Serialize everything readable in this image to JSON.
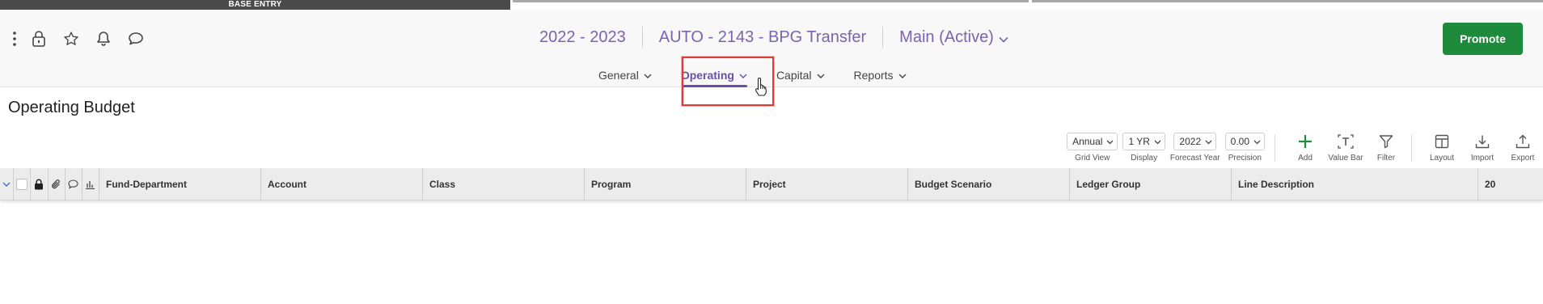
{
  "progress": {
    "stage_label": "BASE ENTRY"
  },
  "header": {
    "left_icons": [
      "more-vertical-icon",
      "lock-icon",
      "star-icon",
      "bell-icon",
      "comment-icon"
    ],
    "fiscal_year": "2022 - 2023",
    "process_name": "AUTO - 2143 - BPG Transfer",
    "scenario": "Main (Active)",
    "promote_label": "Promote",
    "brand_color": "#7b63b0",
    "promote_color": "#1e8a3c"
  },
  "nav": {
    "tabs": [
      {
        "label": "General",
        "active": false
      },
      {
        "label": "Operating",
        "active": true
      },
      {
        "label": "Capital",
        "active": false
      },
      {
        "label": "Reports",
        "active": false
      }
    ]
  },
  "page": {
    "title": "Operating Budget"
  },
  "toolbar": {
    "selects": [
      {
        "value": "Annual",
        "label": "Grid View"
      },
      {
        "value": "1 YR",
        "label": "Display"
      },
      {
        "value": "2022",
        "label": "Forecast Year"
      },
      {
        "value": "0.00",
        "label": "Precision"
      }
    ],
    "buttons": [
      {
        "label": "Add",
        "icon": "plus-icon"
      },
      {
        "label": "Value Bar",
        "icon": "text-box-icon"
      },
      {
        "label": "Filter",
        "icon": "filter-icon"
      },
      {
        "label": "Layout",
        "icon": "layout-icon"
      },
      {
        "label": "Import",
        "icon": "import-icon"
      },
      {
        "label": "Export",
        "icon": "export-icon"
      }
    ]
  },
  "grid": {
    "columns": [
      "Fund-Department",
      "Account",
      "Class",
      "Program",
      "Project",
      "Budget Scenario",
      "Ledger Group",
      "Line Description",
      "20"
    ]
  }
}
